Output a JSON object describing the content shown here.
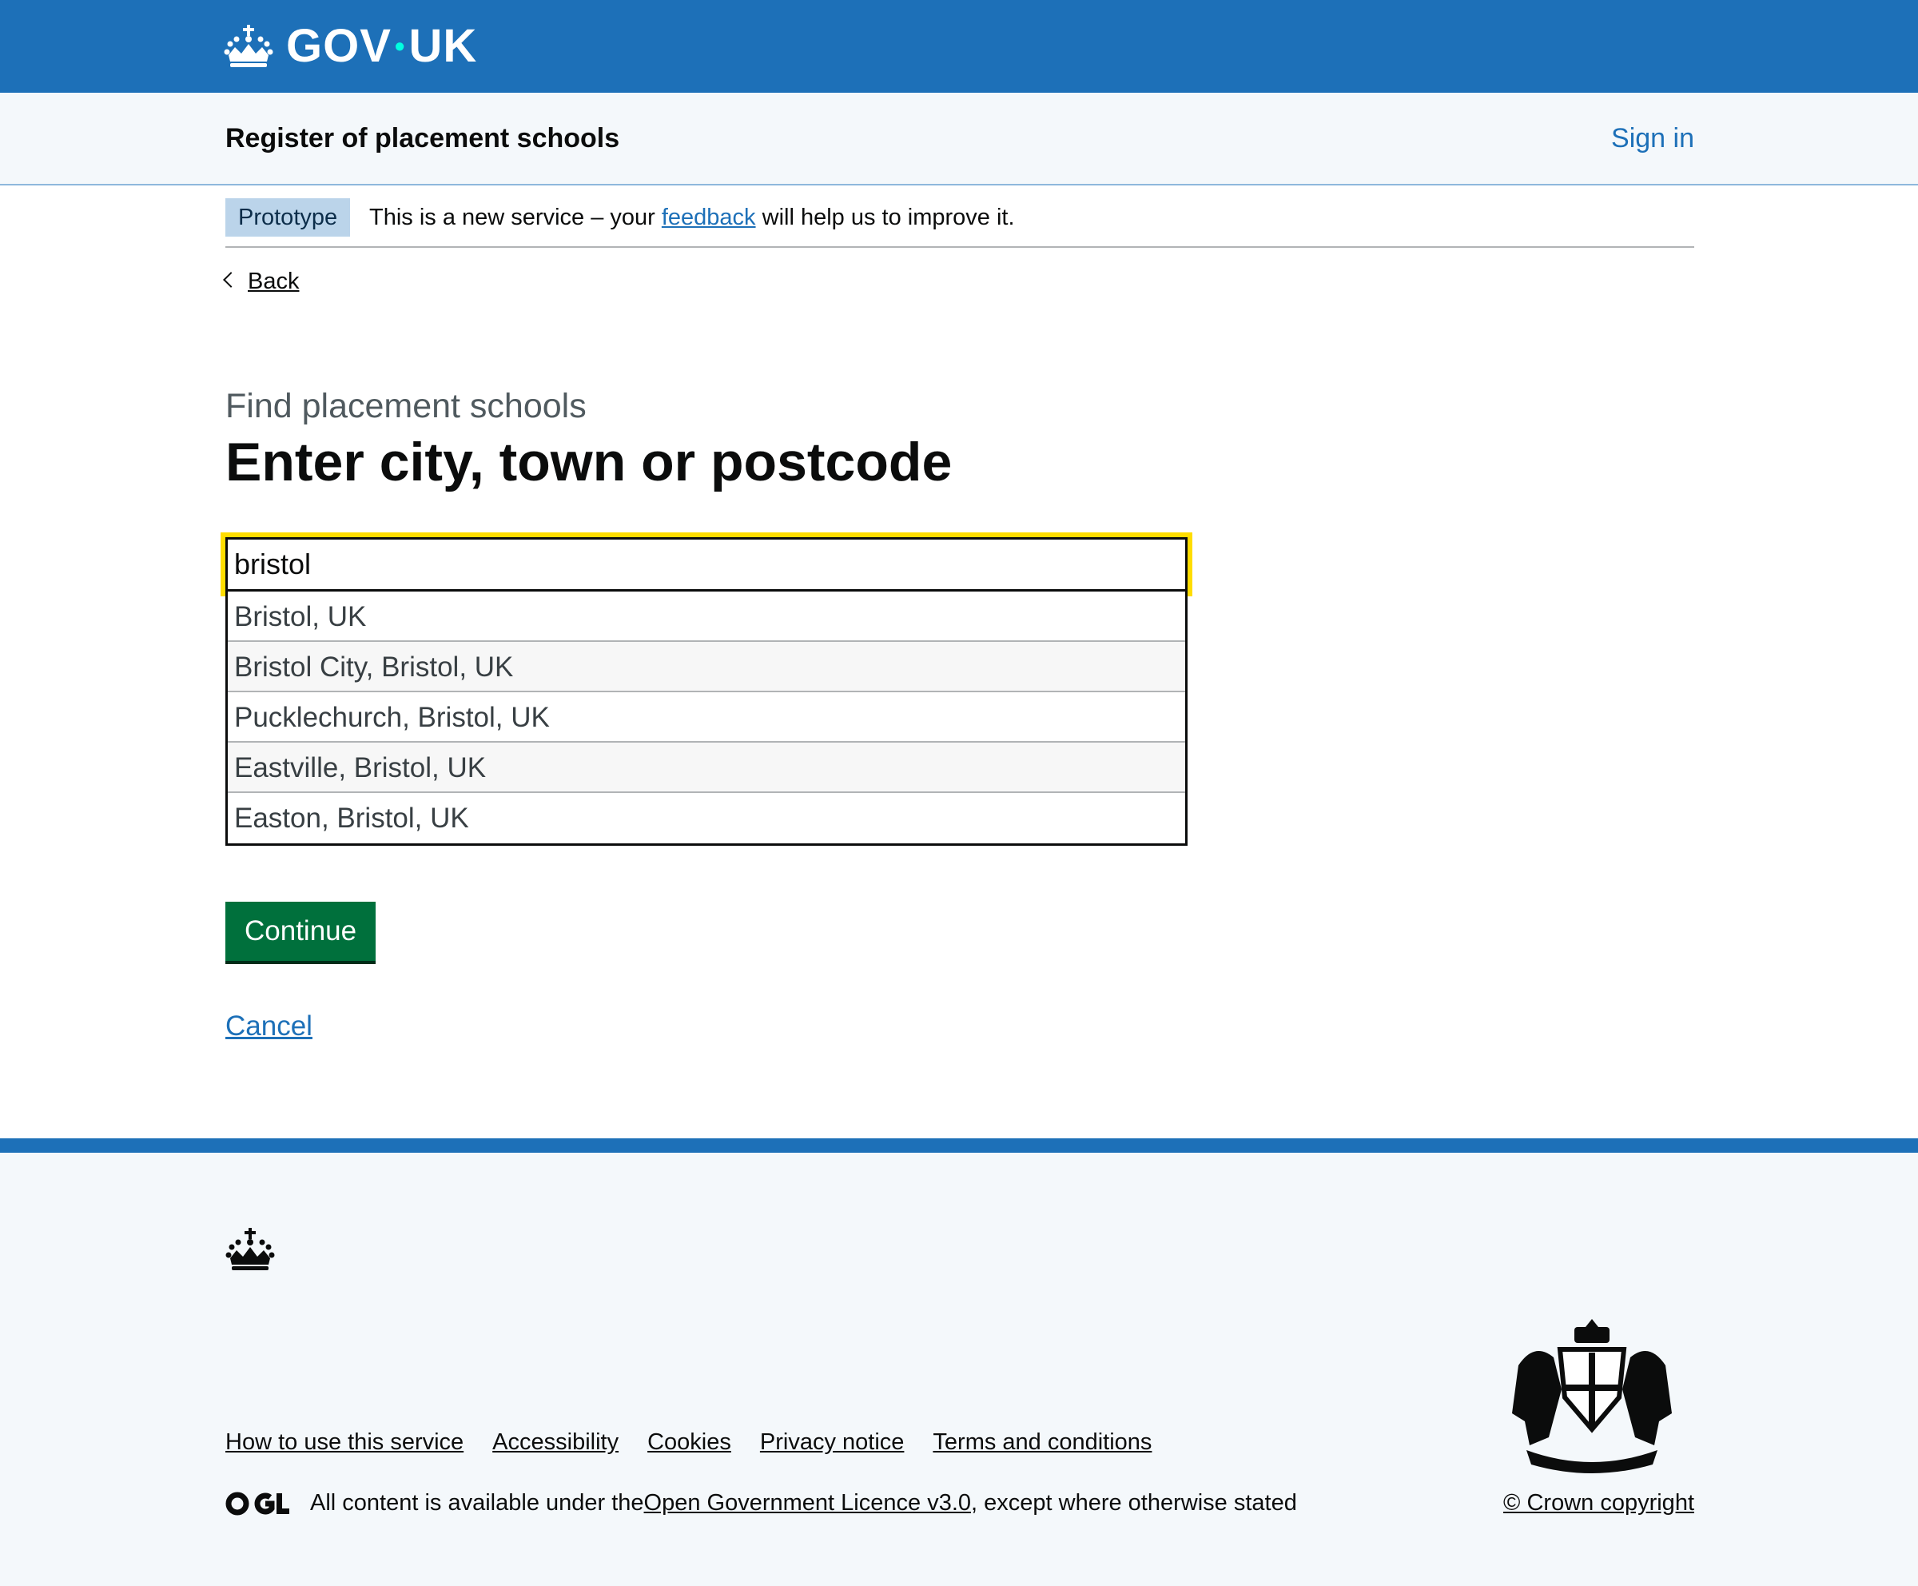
{
  "header": {
    "logo_text_left": "GOV",
    "logo_dot": "•",
    "logo_text_right": "UK",
    "logo_icon": "crown-icon",
    "brand_color": "#1d70b8"
  },
  "service_nav": {
    "service_name": "Register of placement schools",
    "sign_in": "Sign in"
  },
  "phase_banner": {
    "tag": "Prototype",
    "text_before": "This is a new service – your ",
    "link": "feedback",
    "text_after": " will help us to improve it."
  },
  "back_link": "Back",
  "main": {
    "caption": "Find placement schools",
    "heading": "Enter city, town or postcode",
    "search_value": "bristol",
    "suggestions": [
      "Bristol, UK",
      "Bristol City, Bristol, UK",
      "Pucklechurch, Bristol, UK",
      "Eastville, Bristol, UK",
      "Easton, Bristol, UK"
    ],
    "continue_label": "Continue",
    "cancel_label": "Cancel",
    "button_color": "#00703c"
  },
  "footer": {
    "links": [
      "How to use this service",
      "Accessibility",
      "Cookies",
      "Privacy notice",
      "Terms and conditions"
    ],
    "licence_before": "All content is available under the ",
    "licence_link": "Open Government Licence v3.0",
    "licence_after": ", except where otherwise stated",
    "copyright": "© Crown copyright",
    "icons": [
      "crown-icon",
      "ogl-logo-icon",
      "royal-coat-of-arms-icon"
    ]
  }
}
